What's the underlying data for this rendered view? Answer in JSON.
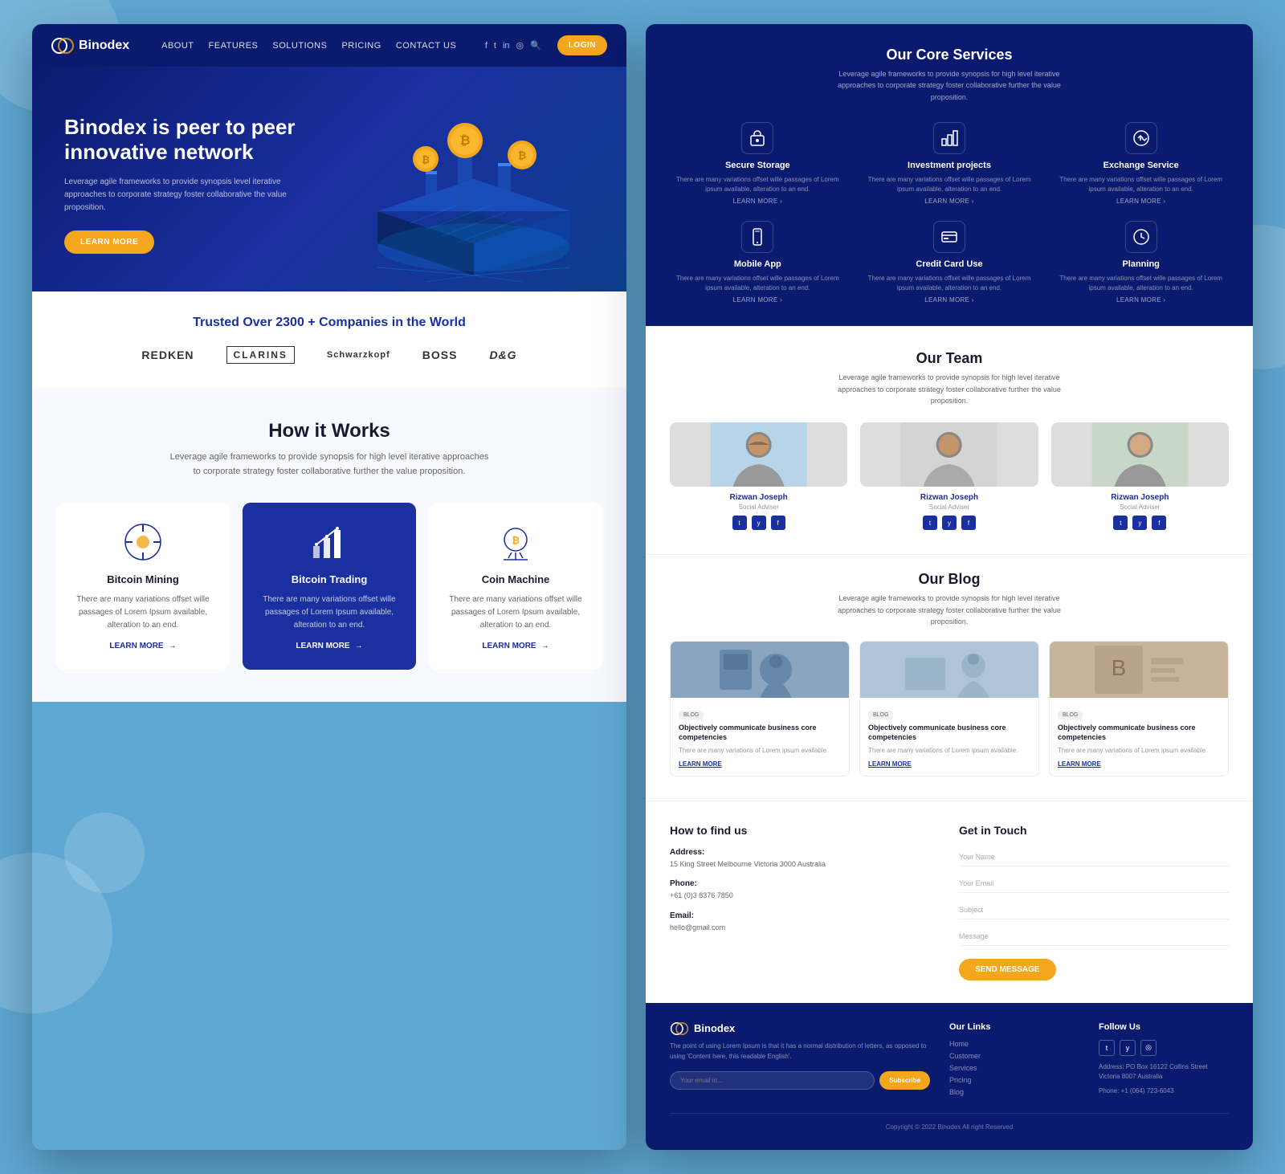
{
  "background": {
    "color": "#5fa8d3"
  },
  "nav": {
    "logo": "Binodex",
    "links": [
      "ABOUT",
      "FEATURES",
      "SOLUTIONS",
      "PRICING",
      "CONTACT US"
    ],
    "loginLabel": "LOGIN"
  },
  "hero": {
    "title": "Binodex is peer to peer innovative network",
    "description": "Leverage agile frameworks to provide synopsis level iterative approaches to corporate strategy foster collaborative the value proposition.",
    "ctaLabel": "LEARN MORE"
  },
  "trusted": {
    "heading": "Trusted Over 2300 + Companies in the World",
    "brands": [
      "REDKEN",
      "CLARINS",
      "Schwarzkopf",
      "BOSS",
      "D&G"
    ]
  },
  "howItWorks": {
    "title": "How it Works",
    "subtitle": "Leverage agile frameworks to provide synopsis for high level iterative approaches to corporate strategy foster collaborative further the value proposition.",
    "cards": [
      {
        "title": "Bitcoin Mining",
        "description": "There are many variations offset wille passages of Lorem Ipsum available, alteration to an end.",
        "learnMore": "LEARN MORE",
        "active": false
      },
      {
        "title": "Bitcoin Trading",
        "description": "There are many variations offset wille passages of Lorem Ipsum available, alteration to an end.",
        "learnMore": "LEARN MORE",
        "active": true
      },
      {
        "title": "Coin Machine",
        "description": "There are many variations offset wille passages of Lorem Ipsum available, alteration to an end.",
        "learnMore": "LEARN MORE",
        "active": false
      }
    ]
  },
  "coreServices": {
    "title": "Our Core Services",
    "subtitle": "Leverage agile frameworks to provide synopsis for high level iterative approaches to corporate strategy foster collaborative further the value proposition.",
    "services": [
      {
        "title": "Secure Storage",
        "desc": "There are many variations offset wille passages of Lorem ipsum available, alteration to an end."
      },
      {
        "title": "Investment projects",
        "desc": "There are many variations offset wille passages of Lorem ipsum available, alteration to an end."
      },
      {
        "title": "Exchange Service",
        "desc": "There are many variations offset wille passages of Lorem ipsum available, alteration to an end."
      },
      {
        "title": "Mobile App",
        "desc": "There are many variations offset wille passages of Lorem ipsum available, alteration to an end."
      },
      {
        "title": "Credit Card Use",
        "desc": "There are many variations offset wille passages of Lorem ipsum available, alteration to an end."
      },
      {
        "title": "Planning",
        "desc": "There are many variations offset wille passages of Lorem ipsum available, alteration to an end."
      }
    ],
    "learnMore": "LEARN MORE"
  },
  "ourTeam": {
    "title": "Our Team",
    "subtitle": "Leverage agile frameworks to provide synopsis for high level iterative approaches to corporate strategy foster collaborative further the value proposition.",
    "members": [
      {
        "name": "Rizwan Joseph",
        "role": "Social Adviser"
      },
      {
        "name": "Rizwan Joseph",
        "role": "Social Adviser"
      },
      {
        "name": "Rizwan Joseph",
        "role": "Social Adviser"
      }
    ]
  },
  "ourBlog": {
    "title": "Our Blog",
    "subtitle": "Leverage agile frameworks to provide synopsis for high level iterative approaches to corporate strategy foster collaborative further the value proposition.",
    "posts": [
      {
        "tag": "BLOG",
        "title": "Objectively communicate business core competencies",
        "desc": "There are many variations of Lorem ipsum available.",
        "learnMore": "Learn More"
      },
      {
        "tag": "BLOG",
        "title": "Objectively communicate business core competencies",
        "desc": "There are many variations of Lorem ipsum available.",
        "learnMore": "Learn More"
      },
      {
        "tag": "BLOG",
        "title": "Objectively communicate business core competencies",
        "desc": "There are many variations of Lorem ipsum available.",
        "learnMore": "Learn More"
      }
    ]
  },
  "contact": {
    "findUsTitle": "How to find us",
    "address": {
      "label": "Address:",
      "value": "15 King Street Melbourne Victoria 3000 Australia"
    },
    "phone": {
      "label": "Phone:",
      "value": "+61 (0)3 8376 7850"
    },
    "email": {
      "label": "Email:",
      "value": "hello@gmail.com"
    },
    "getInTouchTitle": "Get in Touch",
    "form": {
      "namePlaceholder": "Your Name",
      "emailPlaceholder": "Your Email",
      "subjectPlaceholder": "Subject",
      "messagePlaceholder": "Message",
      "submitLabel": "SEND MESSAGE"
    }
  },
  "footer": {
    "logo": "Binodex",
    "description": "The point of using Lorem Ipsum is that it has a normal distribution of letters, as opposed to using 'Content here, this readable English'.",
    "emailPlaceholder": "Your email id...",
    "subscribeLabel": "Subscribe",
    "ourLinks": {
      "title": "Our Links",
      "links": [
        "Home",
        "Customer",
        "Services",
        "Pricing",
        "Blog"
      ]
    },
    "followUs": {
      "title": "Follow Us",
      "address": "Address: PO Box 16122 Collins Street Victoria 8007 Australia",
      "phone": "Phone: +1 (064) 723-6043"
    },
    "copyright": "Copyright © 2022 Binodex All right Reserved"
  }
}
